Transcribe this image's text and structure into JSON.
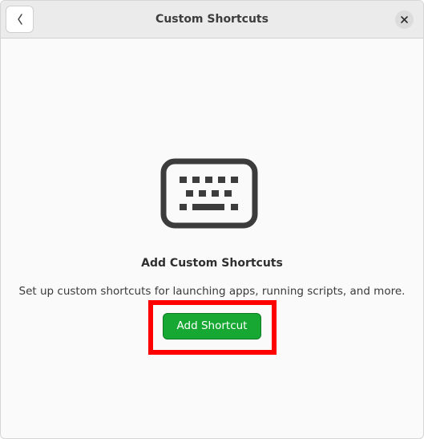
{
  "header": {
    "title": "Custom Shortcuts",
    "back_icon": "chevron-left-icon",
    "close_icon": "close-icon"
  },
  "empty_state": {
    "icon": "keyboard-icon",
    "title": "Add Custom Shortcuts",
    "description": "Set up custom shortcuts for launching apps, running scripts, and more.",
    "button_label": "Add Shortcut"
  },
  "colors": {
    "accent": "#16a832",
    "highlight": "#ff0000"
  }
}
